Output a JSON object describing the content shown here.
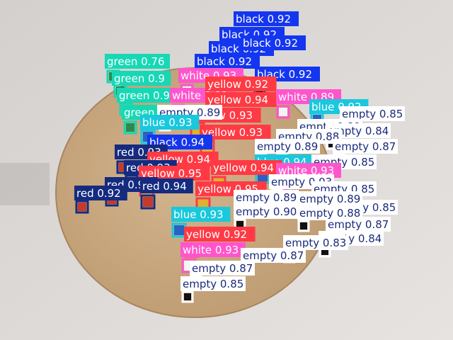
{
  "palette": {
    "black": "#1436f0",
    "green": "#16d8b5",
    "white": "#ff55cc",
    "yellow": "#ff3a44",
    "blue": "#19c8dd",
    "empty": "#ffffff",
    "red": "#152b80"
  },
  "detections": [
    {
      "cls": "black",
      "score": "0.92",
      "text": "black 0.92"
    },
    {
      "cls": "black",
      "score": "0.92",
      "text": "black 0.92"
    },
    {
      "cls": "black",
      "score": "0.92",
      "text": "black 0.92"
    },
    {
      "cls": "black",
      "score": "0.92",
      "text": "black 0.92"
    },
    {
      "cls": "black",
      "score": "0.92",
      "text": "black 0.92"
    },
    {
      "cls": "black",
      "score": "0.92",
      "text": "black 0.92"
    },
    {
      "cls": "green",
      "score": "0.76",
      "text": "green 0.76"
    },
    {
      "cls": "green",
      "score": "0.9",
      "text": "green 0.9"
    },
    {
      "cls": "green",
      "score": "0.9",
      "text": "green 0.9"
    },
    {
      "cls": "green",
      "score": "0.9",
      "text": "green 0.9"
    },
    {
      "cls": "white",
      "score": "0.93",
      "text": "white 0.93"
    },
    {
      "cls": "white",
      "score": "0.92",
      "text": "white 0.92"
    },
    {
      "cls": "yellow",
      "score": "0.92",
      "text": "yellow 0.92"
    },
    {
      "cls": "yellow",
      "score": "0.94",
      "text": "yellow 0.94"
    },
    {
      "cls": "yellow",
      "score": "0.93",
      "text": "yellow 0.93"
    },
    {
      "cls": "yellow",
      "score": "0.93",
      "text": "yellow 0.93"
    },
    {
      "cls": "white",
      "score": "0.89",
      "text": "white 0.89"
    },
    {
      "cls": "empty",
      "score": "0.89",
      "text": "empty 0.89"
    },
    {
      "cls": "blue",
      "score": "0.92",
      "text": "blue 0.92"
    },
    {
      "cls": "empty",
      "score": "0.85",
      "text": "empty 0.85"
    },
    {
      "cls": "blue",
      "score": "0.93",
      "text": "blue 0.93"
    },
    {
      "cls": "empty",
      "score": "0.89",
      "text": "empty 0.89"
    },
    {
      "cls": "empty",
      "score": "0.84",
      "text": "empty 0.84"
    },
    {
      "cls": "empty",
      "score": "0.88",
      "text": "empty 0.88"
    },
    {
      "cls": "black",
      "score": "0.94",
      "text": "black 0.94"
    },
    {
      "cls": "empty",
      "score": "0.89",
      "text": "empty 0.89"
    },
    {
      "cls": "empty",
      "score": "0.87",
      "text": "empty 0.87"
    },
    {
      "cls": "red",
      "score": "0.93",
      "text": "red 0.93"
    },
    {
      "cls": "yellow",
      "score": "0.94",
      "text": "yellow 0.94"
    },
    {
      "cls": "blue",
      "score": "0.94",
      "text": "blue 0.94"
    },
    {
      "cls": "empty",
      "score": "0.85",
      "text": "empty 0.85"
    },
    {
      "cls": "red",
      "score": "0.93",
      "text": "red 0.93"
    },
    {
      "cls": "yellow",
      "score": "0.95",
      "text": "yellow 0.95"
    },
    {
      "cls": "yellow",
      "score": "0.94",
      "text": "yellow 0.94"
    },
    {
      "cls": "white",
      "score": "0.93",
      "text": "white 0.93"
    },
    {
      "cls": "red",
      "score": "0.93",
      "text": "red 0.93"
    },
    {
      "cls": "red",
      "score": "0.94",
      "text": "red 0.94"
    },
    {
      "cls": "empty",
      "score": "0.93",
      "text": "empty 0.93"
    },
    {
      "cls": "yellow",
      "score": "0.95",
      "text": "yellow 0.95"
    },
    {
      "cls": "empty",
      "score": "0.85",
      "text": "empty 0.85"
    },
    {
      "cls": "red",
      "score": "0.92",
      "text": "red 0.92"
    },
    {
      "cls": "empty",
      "score": "0.89",
      "text": "empty 0.89"
    },
    {
      "cls": "empty",
      "score": "0.85",
      "text": "empty 0.85"
    },
    {
      "cls": "empty",
      "score": "0.90",
      "text": "empty 0.90"
    },
    {
      "cls": "empty",
      "score": "0.89",
      "text": "empty 0.89"
    },
    {
      "cls": "blue",
      "score": "0.93",
      "text": "blue 0.93"
    },
    {
      "cls": "empty",
      "score": "0.87",
      "text": "empty 0.87"
    },
    {
      "cls": "empty",
      "score": "0.88",
      "text": "empty 0.88"
    },
    {
      "cls": "yellow",
      "score": "0.92",
      "text": "yellow 0.92"
    },
    {
      "cls": "empty",
      "score": "0.84",
      "text": "empty 0.84"
    },
    {
      "cls": "white",
      "score": "0.93",
      "text": "white 0.93"
    },
    {
      "cls": "empty",
      "score": "0.83",
      "text": "empty 0.83"
    },
    {
      "cls": "empty",
      "score": "0.87",
      "text": "empty 0.87"
    },
    {
      "cls": "empty",
      "score": "0.87",
      "text": "empty 0.87"
    },
    {
      "cls": "empty",
      "score": "0.85",
      "text": "empty 0.85"
    }
  ]
}
